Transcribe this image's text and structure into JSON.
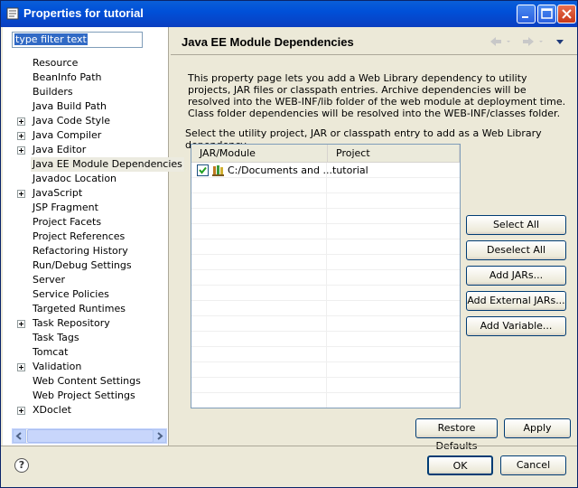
{
  "window": {
    "title": "Properties for tutorial"
  },
  "filter": {
    "placeholder": "type filter text"
  },
  "tree": {
    "items": [
      {
        "label": "Resource",
        "expandable": false
      },
      {
        "label": "BeanInfo Path",
        "expandable": false
      },
      {
        "label": "Builders",
        "expandable": false
      },
      {
        "label": "Java Build Path",
        "expandable": false
      },
      {
        "label": "Java Code Style",
        "expandable": true
      },
      {
        "label": "Java Compiler",
        "expandable": true
      },
      {
        "label": "Java Editor",
        "expandable": true
      },
      {
        "label": "Java EE Module Dependencies",
        "expandable": false,
        "selected": true
      },
      {
        "label": "Javadoc Location",
        "expandable": false
      },
      {
        "label": "JavaScript",
        "expandable": true
      },
      {
        "label": "JSP Fragment",
        "expandable": false
      },
      {
        "label": "Project Facets",
        "expandable": false
      },
      {
        "label": "Project References",
        "expandable": false
      },
      {
        "label": "Refactoring History",
        "expandable": false
      },
      {
        "label": "Run/Debug Settings",
        "expandable": false
      },
      {
        "label": "Server",
        "expandable": false
      },
      {
        "label": "Service Policies",
        "expandable": false
      },
      {
        "label": "Targeted Runtimes",
        "expandable": false
      },
      {
        "label": "Task Repository",
        "expandable": true
      },
      {
        "label": "Task Tags",
        "expandable": false
      },
      {
        "label": "Tomcat",
        "expandable": false
      },
      {
        "label": "Validation",
        "expandable": true
      },
      {
        "label": "Web Content Settings",
        "expandable": false
      },
      {
        "label": "Web Project Settings",
        "expandable": false
      },
      {
        "label": "XDoclet",
        "expandable": true
      }
    ]
  },
  "page": {
    "title": "Java EE Module Dependencies",
    "description": "This property page lets you add a Web Library dependency to utility projects, JAR files or classpath entries. Archive dependencies will be resolved into the WEB-INF/lib folder of the web module at deployment time. Class folder dependencies will be resolved into the WEB-INF/classes folder.",
    "select_label": "Select the utility project, JAR or classpath entry to add as a Web Library dependency"
  },
  "table": {
    "columns": [
      "JAR/Module",
      "Project"
    ],
    "rows": [
      {
        "module": "C:/Documents and ...",
        "project": "tutorial",
        "checked": true
      }
    ]
  },
  "buttons": {
    "select_all": "Select All",
    "deselect_all": "Deselect All",
    "add_jars": "Add JARs...",
    "add_external_jars": "Add External JARs...",
    "add_variable": "Add Variable...",
    "restore_defaults": "Restore Defaults",
    "apply": "Apply",
    "ok": "OK",
    "cancel": "Cancel"
  },
  "help": {
    "symbol": "?"
  }
}
